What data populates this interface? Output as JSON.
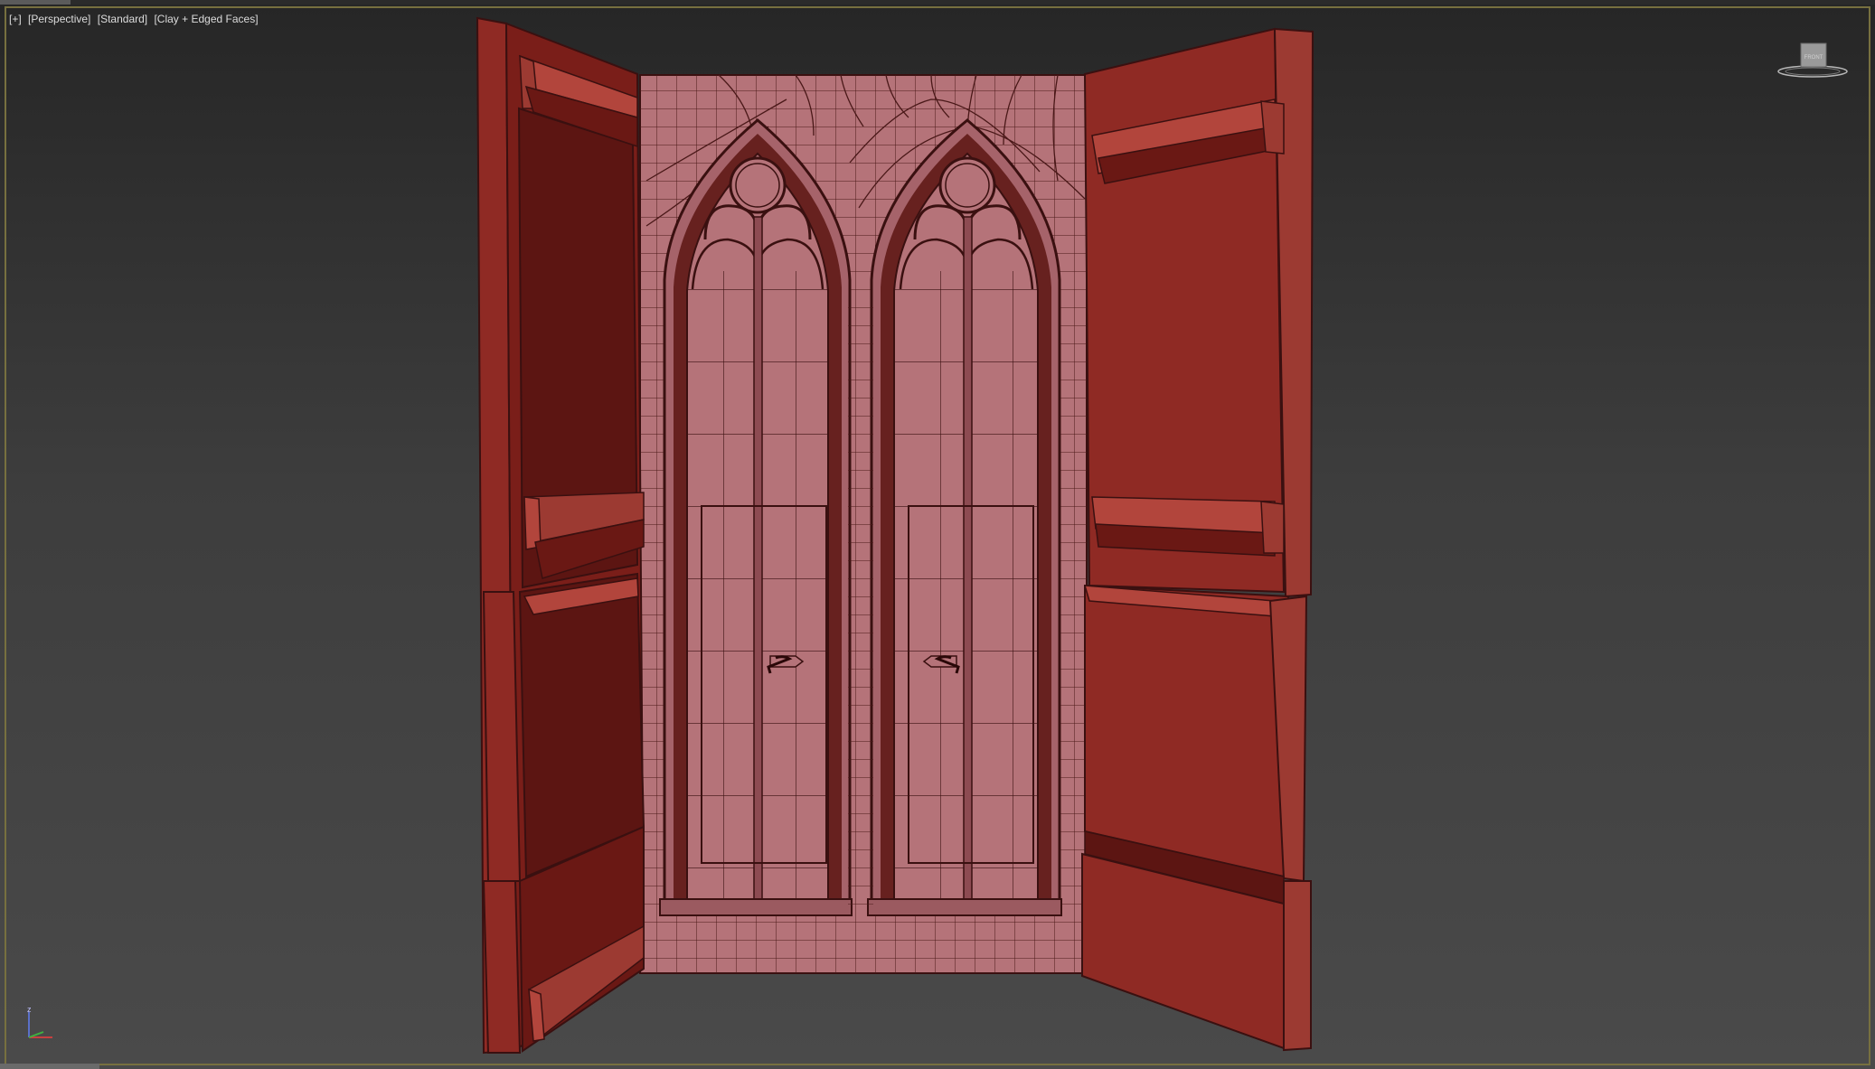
{
  "viewport": {
    "labels": [
      "[+]",
      "[Perspective]",
      "[Standard]",
      "[Clay + Edged Faces]"
    ]
  },
  "viewcube": {
    "face_label": "FRONT"
  },
  "axis": {
    "z": "z",
    "x": "x",
    "y": "y"
  },
  "colors": {
    "viewport_border": "#77703f",
    "wall_clay": "#b57379",
    "shutter_red": "#8f2a24",
    "panel_dark": "#5c1512",
    "edge_lines": "#3a1010"
  },
  "icons": [
    "viewcube-icon",
    "axis-tripod-icon"
  ]
}
